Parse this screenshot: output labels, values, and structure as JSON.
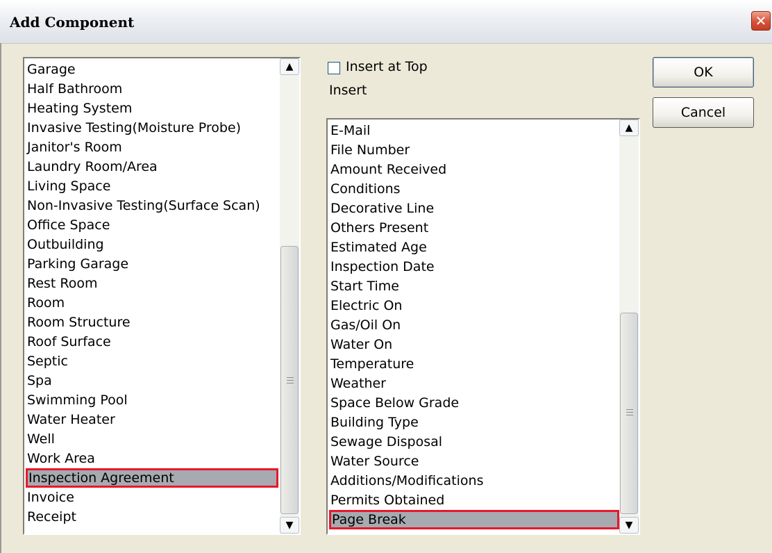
{
  "dialog": {
    "title": "Add Component",
    "close_glyph": "✕"
  },
  "left_list": {
    "items": [
      {
        "label": "Garage"
      },
      {
        "label": "Half Bathroom"
      },
      {
        "label": "Heating System"
      },
      {
        "label": "Invasive Testing(Moisture Probe)"
      },
      {
        "label": "Janitor's Room"
      },
      {
        "label": "Laundry Room/Area"
      },
      {
        "label": "Living Space"
      },
      {
        "label": "Non-Invasive Testing(Surface Scan)"
      },
      {
        "label": "Office Space"
      },
      {
        "label": "Outbuilding"
      },
      {
        "label": "Parking Garage"
      },
      {
        "label": "Rest Room"
      },
      {
        "label": "Room"
      },
      {
        "label": "Room Structure"
      },
      {
        "label": "Roof Surface"
      },
      {
        "label": "Septic"
      },
      {
        "label": "Spa"
      },
      {
        "label": "Swimming Pool"
      },
      {
        "label": "Water Heater"
      },
      {
        "label": "Well"
      },
      {
        "label": "Work Area"
      },
      {
        "label": "Inspection Agreement",
        "highlighted": true
      },
      {
        "label": "Invoice"
      },
      {
        "label": "Receipt"
      }
    ]
  },
  "insert_at_top": {
    "label": "Insert at Top",
    "checked": false
  },
  "insert_label": "Insert",
  "right_list": {
    "items": [
      {
        "label": "E-Mail"
      },
      {
        "label": "File Number"
      },
      {
        "label": "Amount Received"
      },
      {
        "label": "Conditions"
      },
      {
        "label": "Decorative Line"
      },
      {
        "label": "Others Present"
      },
      {
        "label": "Estimated Age"
      },
      {
        "label": "Inspection Date"
      },
      {
        "label": "Start Time"
      },
      {
        "label": "Electric On"
      },
      {
        "label": "Gas/Oil On"
      },
      {
        "label": "Water On"
      },
      {
        "label": "Temperature"
      },
      {
        "label": "Weather"
      },
      {
        "label": "Space Below Grade"
      },
      {
        "label": "Building Type"
      },
      {
        "label": "Sewage Disposal"
      },
      {
        "label": "Water Source"
      },
      {
        "label": "Additions/Modifications"
      },
      {
        "label": "Permits Obtained"
      },
      {
        "label": "Page Break",
        "highlighted": true
      }
    ]
  },
  "buttons": {
    "ok": "OK",
    "cancel": "Cancel"
  },
  "icons": {
    "scroll_up": "▲",
    "scroll_down": "▼"
  },
  "colors": {
    "dialog_bg": "#ece9d8",
    "highlight_bg": "#a7aab1",
    "highlight_border": "#e8182a",
    "close_button": "#d8523a"
  }
}
